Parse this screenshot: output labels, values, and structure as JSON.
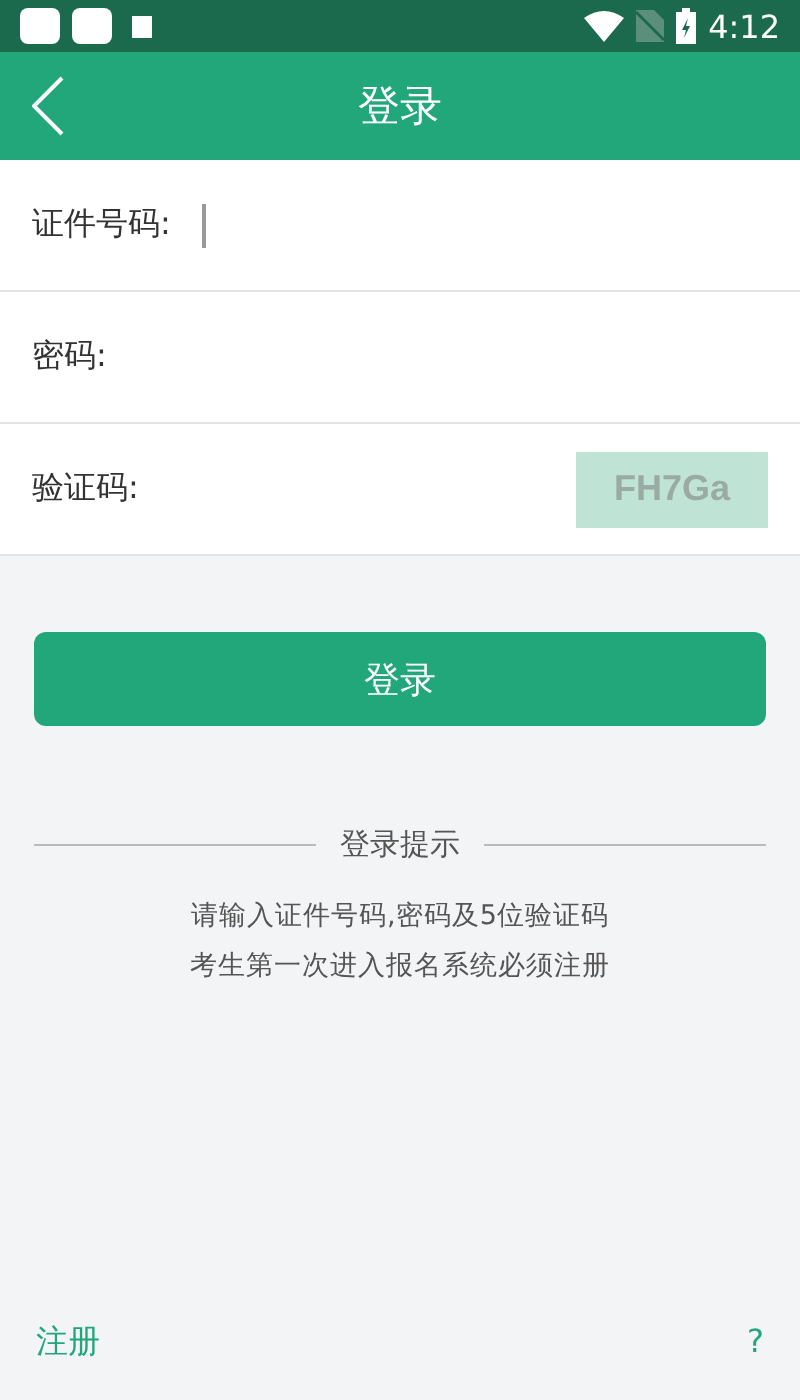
{
  "status_bar": {
    "time": "4:12"
  },
  "header": {
    "title": "登录"
  },
  "fields": [
    {
      "label": "证件号码:",
      "focused": true
    },
    {
      "label": "密码:",
      "focused": false
    },
    {
      "label": "验证码:",
      "focused": false,
      "captcha": "FH7Ga"
    }
  ],
  "login_button": "登录",
  "hint": {
    "title": "登录提示",
    "lines": [
      "请输入证件号码,密码及5位验证码",
      "考生第一次进入报名系统必须注册"
    ]
  },
  "footer": {
    "register": "注册",
    "right_link": "?"
  }
}
